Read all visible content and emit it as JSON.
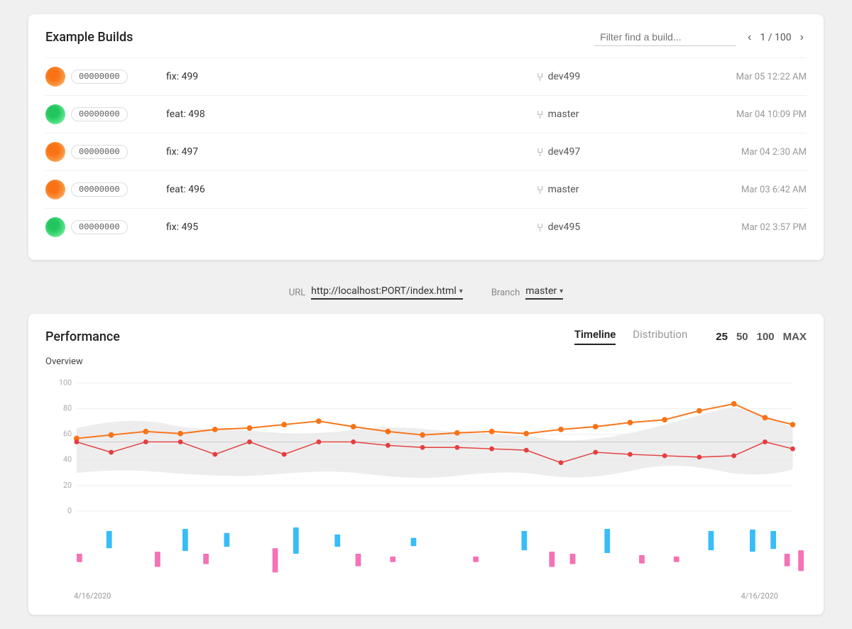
{
  "page": {
    "title": "Example Builds"
  },
  "filter": {
    "placeholder": "Filter find a build..."
  },
  "pagination": {
    "current": 1,
    "total": 100,
    "display": "1 / 100"
  },
  "builds": [
    {
      "id": "00000000",
      "name": "fix: 499",
      "branch": "dev499",
      "date": "Mar 05 12:22 AM",
      "avatar_type": "1"
    },
    {
      "id": "00000000",
      "name": "feat: 498",
      "branch": "master",
      "date": "Mar 04 10:09 PM",
      "avatar_type": "2"
    },
    {
      "id": "00000000",
      "name": "fix: 497",
      "branch": "dev497",
      "date": "Mar 04 2:30 AM",
      "avatar_type": "3"
    },
    {
      "id": "00000000",
      "name": "feat: 496",
      "branch": "master",
      "date": "Mar 03 6:42 AM",
      "avatar_type": "4"
    },
    {
      "id": "00000000",
      "name": "fix: 495",
      "branch": "dev495",
      "date": "Mar 02 3:57 PM",
      "avatar_type": "5"
    }
  ],
  "url_bar": {
    "url_label": "URL",
    "url_value": "http://localhost:PORT/index.html",
    "branch_label": "Branch",
    "branch_value": "master"
  },
  "performance": {
    "title": "Performance",
    "tabs": [
      "Timeline",
      "Distribution"
    ],
    "active_tab": "Timeline",
    "count_buttons": [
      "25",
      "50",
      "100",
      "MAX"
    ],
    "active_count": "25",
    "overview_label": "Overview",
    "y_axis": [
      "100",
      "80",
      "60",
      "40",
      "20",
      "0"
    ],
    "date_start": "4/16/2020",
    "date_end": "4/16/2020"
  }
}
